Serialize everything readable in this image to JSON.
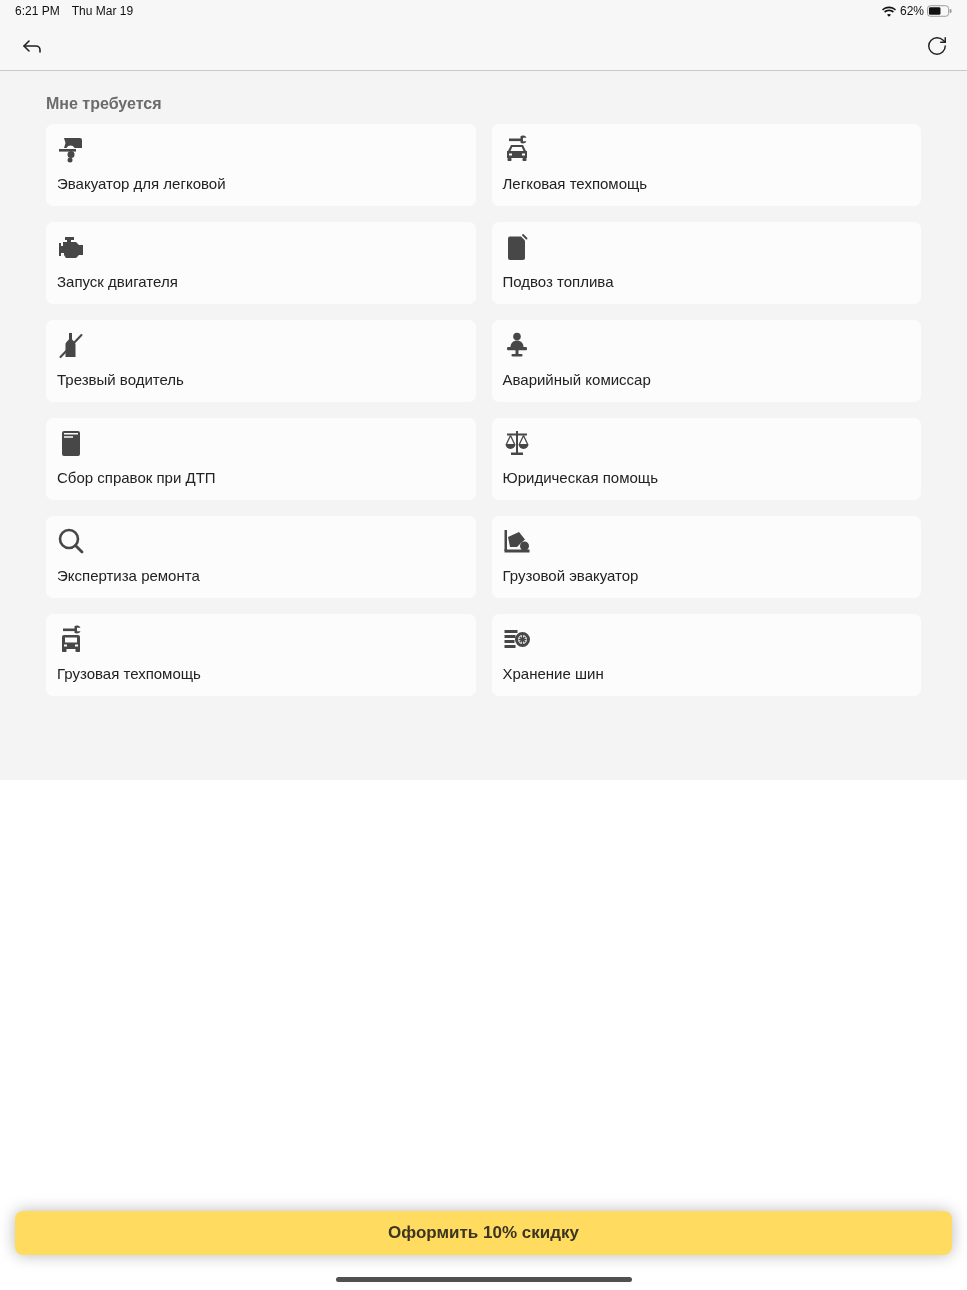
{
  "status_bar": {
    "time": "6:21 PM",
    "date": "Thu Mar 19",
    "battery": "62%"
  },
  "section_title": "Мне требуется",
  "services": [
    {
      "kind": "cartow",
      "label": "Эвакуатор для легковой"
    },
    {
      "kind": "carservice",
      "label": "Легковая техпомощь"
    },
    {
      "kind": "engine",
      "label": "Запуск двигателя"
    },
    {
      "kind": "fuel",
      "label": "Подвоз топлива"
    },
    {
      "kind": "sober",
      "label": "Трезвый водитель"
    },
    {
      "kind": "commissar",
      "label": "Аварийный комиссар"
    },
    {
      "kind": "papers",
      "label": "Сбор справок при ДТП"
    },
    {
      "kind": "legal",
      "label": "Юридическая помощь"
    },
    {
      "kind": "inspection",
      "label": "Экспертиза ремонта"
    },
    {
      "kind": "trucktow",
      "label": "Грузовой эвакуатор"
    },
    {
      "kind": "truckservice",
      "label": "Грузовая техпомощь"
    },
    {
      "kind": "tires",
      "label": "Хранение шин"
    }
  ],
  "action_button": {
    "label": "Оформить 10% скидку"
  }
}
